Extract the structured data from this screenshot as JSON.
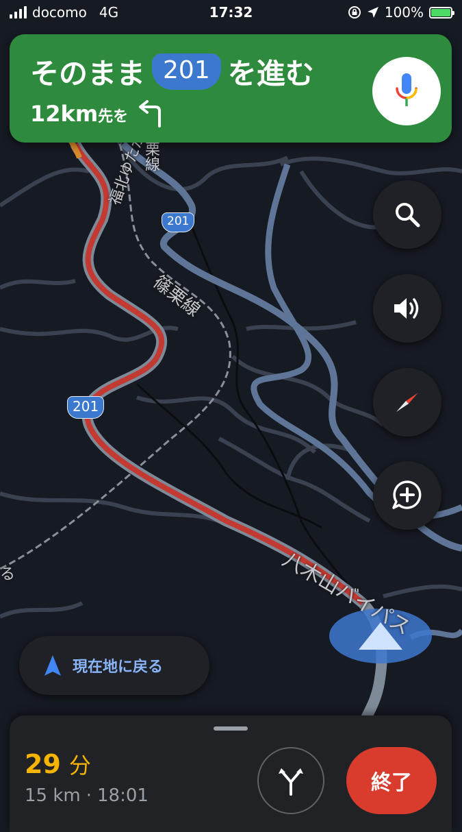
{
  "status_bar": {
    "carrier": "docomo",
    "network": "4G",
    "time": "17:32",
    "battery_percent": "100%",
    "icons": [
      "signal-icon",
      "rotation-lock-icon",
      "location-arrow-icon",
      "battery-charging-icon"
    ]
  },
  "banner": {
    "instruction_prefix": "そのまま",
    "route_number": "201",
    "instruction_suffix": "を進む",
    "distance": "12km",
    "distance_suffix": "先を",
    "next_turn_icon": "turn-left-icon",
    "background_color": "#2e8b3e"
  },
  "map": {
    "road_labels": [
      "栗線",
      "福北ゆたか線",
      "篠栗線",
      "八木山バイパス"
    ],
    "shield_upper": "201",
    "shield_lower": "201",
    "edge_label": "る"
  },
  "side_buttons": [
    "search-icon",
    "volume-icon",
    "compass-icon",
    "add-report-icon"
  ],
  "recenter": {
    "label": "現在地に戻る"
  },
  "trip": {
    "duration_value": "29",
    "duration_unit": "分",
    "distance": "15 km",
    "separator": "·",
    "arrival_time": "18:01",
    "end_label": "終了"
  },
  "colors": {
    "eta": "#f4b400",
    "end_button": "#d93c2d",
    "route_line": "#c23a32",
    "route_shield": "#3d78cf",
    "recenter_text": "#8ab4f8"
  }
}
